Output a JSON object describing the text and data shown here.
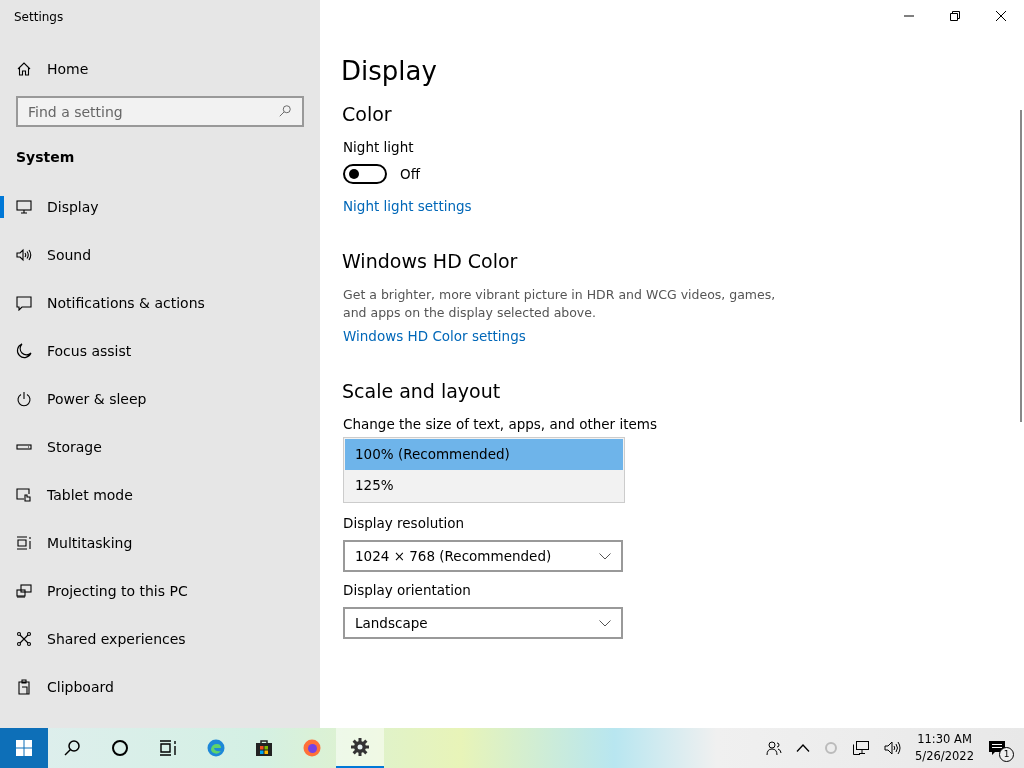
{
  "window": {
    "title": "Settings"
  },
  "sidebar": {
    "home": "Home",
    "search": {
      "placeholder": "Find a setting"
    },
    "section": "System",
    "items": [
      {
        "label": "Display",
        "kind": "display",
        "selected": true
      },
      {
        "label": "Sound",
        "kind": "sound",
        "selected": false
      },
      {
        "label": "Notifications & actions",
        "kind": "notifications",
        "selected": false
      },
      {
        "label": "Focus assist",
        "kind": "moon",
        "selected": false
      },
      {
        "label": "Power & sleep",
        "kind": "power",
        "selected": false
      },
      {
        "label": "Storage",
        "kind": "storage",
        "selected": false
      },
      {
        "label": "Tablet mode",
        "kind": "tablet",
        "selected": false
      },
      {
        "label": "Multitasking",
        "kind": "multitask",
        "selected": false
      },
      {
        "label": "Projecting to this PC",
        "kind": "project",
        "selected": false
      },
      {
        "label": "Shared experiences",
        "kind": "shared",
        "selected": false
      },
      {
        "label": "Clipboard",
        "kind": "clipboard",
        "selected": false
      }
    ]
  },
  "main": {
    "title": "Display",
    "color": {
      "heading": "Color",
      "night_light": {
        "label": "Night light",
        "on": false,
        "state": "Off"
      },
      "link": "Night light settings"
    },
    "hd_color": {
      "heading": "Windows HD Color",
      "description": "Get a brighter, more vibrant picture in HDR and WCG videos, games, and apps on the display selected above.",
      "link": "Windows HD Color settings"
    },
    "scale": {
      "heading": "Scale and layout",
      "size_label": "Change the size of text, apps, and other items",
      "size_options": [
        {
          "label": "100% (Recommended)",
          "selected": true
        },
        {
          "label": "125%",
          "selected": false
        }
      ],
      "resolution": {
        "label": "Display resolution",
        "value": "1024 × 768 (Recommended)"
      },
      "orientation": {
        "label": "Display orientation",
        "value": "Landscape"
      }
    }
  },
  "taskbar": {
    "apps": [
      {
        "kind": "start",
        "selected": false
      },
      {
        "kind": "search",
        "selected": false
      },
      {
        "kind": "cortana",
        "selected": false
      },
      {
        "kind": "taskview",
        "selected": false
      },
      {
        "kind": "edge",
        "selected": false
      },
      {
        "kind": "store",
        "selected": false
      },
      {
        "kind": "firefox",
        "selected": false
      },
      {
        "kind": "settings",
        "selected": true
      }
    ],
    "time": "11:30 AM",
    "date": "5/26/2022",
    "notification_count": "1"
  }
}
